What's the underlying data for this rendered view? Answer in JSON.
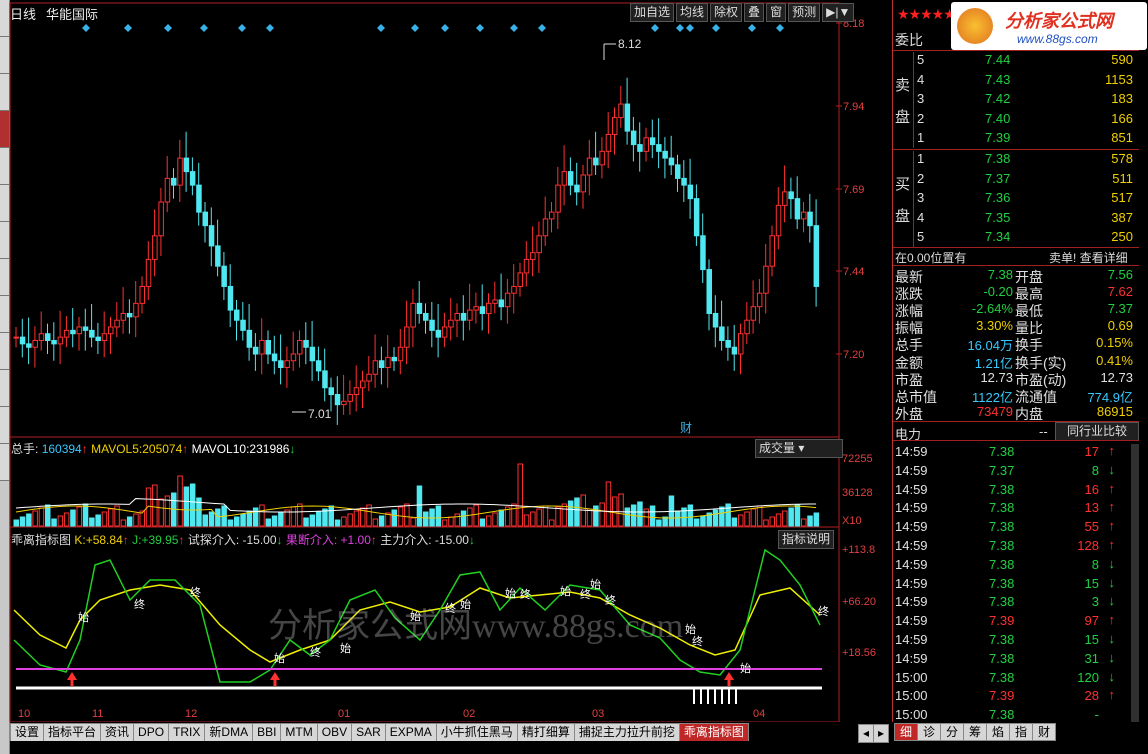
{
  "header": {
    "period": "日线",
    "stock_name": "华能国际"
  },
  "toolbar": [
    "加自选",
    "均线",
    "除权",
    "叠",
    "窗",
    "预测",
    "▶|▼"
  ],
  "price_axis": [
    "8.18",
    "7.94",
    "7.69",
    "7.44",
    "7.20"
  ],
  "price_marks": {
    "high": "8.12",
    "low": "7.01",
    "caibiao": "财"
  },
  "volume": {
    "label": "总手:",
    "value": "160394",
    "ma5_label": "MAVOL5:",
    "ma5": "205074",
    "ma10_label": "MAVOL10:",
    "ma10": "231986",
    "button": "成交量",
    "axis": [
      "72255",
      "36128",
      "X10"
    ]
  },
  "indicator": {
    "name": "乖离指标图",
    "k_label": "K:",
    "k": "+58.84",
    "j_label": "J:",
    "j": "+39.95",
    "t1": "试探介入: -15.00",
    "t2": "果断介入: +1.00",
    "t3": "主力介入: -15.00",
    "button": "指标说明",
    "axis": [
      "+113.8",
      "+66.20",
      "+18.56"
    ]
  },
  "markers": {
    "start": "始",
    "end": "终"
  },
  "x_axis": [
    "10",
    "11",
    "12",
    "01",
    "02",
    "03",
    "04"
  ],
  "watermark": "分析家公式网www.88gs.com",
  "logo": {
    "text": "分析家公式网",
    "url": "www.88gs.com"
  },
  "tabs": [
    "设置",
    "指标平台",
    "资讯",
    "DPO",
    "TRIX",
    "新DMA",
    "BBI",
    "MTM",
    "OBV",
    "SAR",
    "EXPMA",
    "小牛抓住黑马",
    "精打细算",
    "捕捉主力拉升前挖",
    "乖离指标图"
  ],
  "right_tabs": [
    "细",
    "诊",
    "分",
    "筹",
    "焰",
    "指",
    "财"
  ],
  "quote": {
    "weibi": "委比",
    "sell_label": [
      "卖",
      "盘"
    ],
    "buy_label": [
      "买",
      "盘"
    ],
    "sell": [
      {
        "lvl": "5",
        "price": "7.44",
        "vol": "590"
      },
      {
        "lvl": "4",
        "price": "7.43",
        "vol": "1153"
      },
      {
        "lvl": "3",
        "price": "7.42",
        "vol": "183"
      },
      {
        "lvl": "2",
        "price": "7.40",
        "vol": "166"
      },
      {
        "lvl": "1",
        "price": "7.39",
        "vol": "851"
      }
    ],
    "buy": [
      {
        "lvl": "1",
        "price": "7.38",
        "vol": "578"
      },
      {
        "lvl": "2",
        "price": "7.37",
        "vol": "511"
      },
      {
        "lvl": "3",
        "price": "7.36",
        "vol": "517"
      },
      {
        "lvl": "4",
        "price": "7.35",
        "vol": "387"
      },
      {
        "lvl": "5",
        "price": "7.34",
        "vol": "250"
      }
    ],
    "position_note": "在0.00位置有",
    "sell_order": "卖单! 查看详细",
    "stats": [
      {
        "l1": "最新",
        "v1": "7.38",
        "c1": "g",
        "l2": "开盘",
        "v2": "7.56",
        "c2": "g"
      },
      {
        "l1": "涨跌",
        "v1": "-0.20",
        "c1": "g",
        "l2": "最高",
        "v2": "7.62",
        "c2": "r"
      },
      {
        "l1": "涨幅",
        "v1": "-2.64%",
        "c1": "g",
        "l2": "最低",
        "v2": "7.37",
        "c2": "g"
      },
      {
        "l1": "振幅",
        "v1": "3.30%",
        "c1": "y",
        "l2": "量比",
        "v2": "0.69",
        "c2": "y"
      },
      {
        "l1": "总手",
        "v1": "16.04万",
        "c1": "c",
        "l2": "换手",
        "v2": "0.15%",
        "c2": "y"
      },
      {
        "l1": "金额",
        "v1": "1.21亿",
        "c1": "c",
        "l2": "换手(实)",
        "v2": "0.41%",
        "c2": "y"
      },
      {
        "l1": "市盈",
        "v1": "12.73",
        "c1": "w",
        "l2": "市盈(动)",
        "v2": "12.73",
        "c2": "w"
      },
      {
        "l1": "总市值",
        "v1": "1122亿",
        "c1": "c",
        "l2": "流通值",
        "v2": "774.9亿",
        "c2": "c"
      },
      {
        "l1": "外盘",
        "v1": "73479",
        "c1": "r",
        "l2": "内盘",
        "v2": "86915",
        "c2": "y"
      }
    ],
    "sector": "电力",
    "sector_dash": "--",
    "compare_btn": "同行业比较",
    "ticks": [
      {
        "t": "14:59",
        "p": "7.38",
        "v": "17",
        "d": "up"
      },
      {
        "t": "14:59",
        "p": "7.37",
        "v": "8",
        "d": "down"
      },
      {
        "t": "14:59",
        "p": "7.38",
        "v": "16",
        "d": "up"
      },
      {
        "t": "14:59",
        "p": "7.38",
        "v": "13",
        "d": "up"
      },
      {
        "t": "14:59",
        "p": "7.38",
        "v": "55",
        "d": "up"
      },
      {
        "t": "14:59",
        "p": "7.38",
        "v": "128",
        "d": "up"
      },
      {
        "t": "14:59",
        "p": "7.38",
        "v": "8",
        "d": "down"
      },
      {
        "t": "14:59",
        "p": "7.38",
        "v": "15",
        "d": "down"
      },
      {
        "t": "14:59",
        "p": "7.38",
        "v": "3",
        "d": "down"
      },
      {
        "t": "14:59",
        "p": "7.39",
        "v": "97",
        "d": "up"
      },
      {
        "t": "14:59",
        "p": "7.38",
        "v": "15",
        "d": "down"
      },
      {
        "t": "14:59",
        "p": "7.38",
        "v": "31",
        "d": "down"
      },
      {
        "t": "15:00",
        "p": "7.38",
        "v": "120",
        "d": "down"
      },
      {
        "t": "15:00",
        "p": "7.39",
        "v": "28",
        "d": "up"
      },
      {
        "t": "15:00",
        "p": "7.38",
        "v": "-",
        "d": ""
      }
    ]
  }
}
